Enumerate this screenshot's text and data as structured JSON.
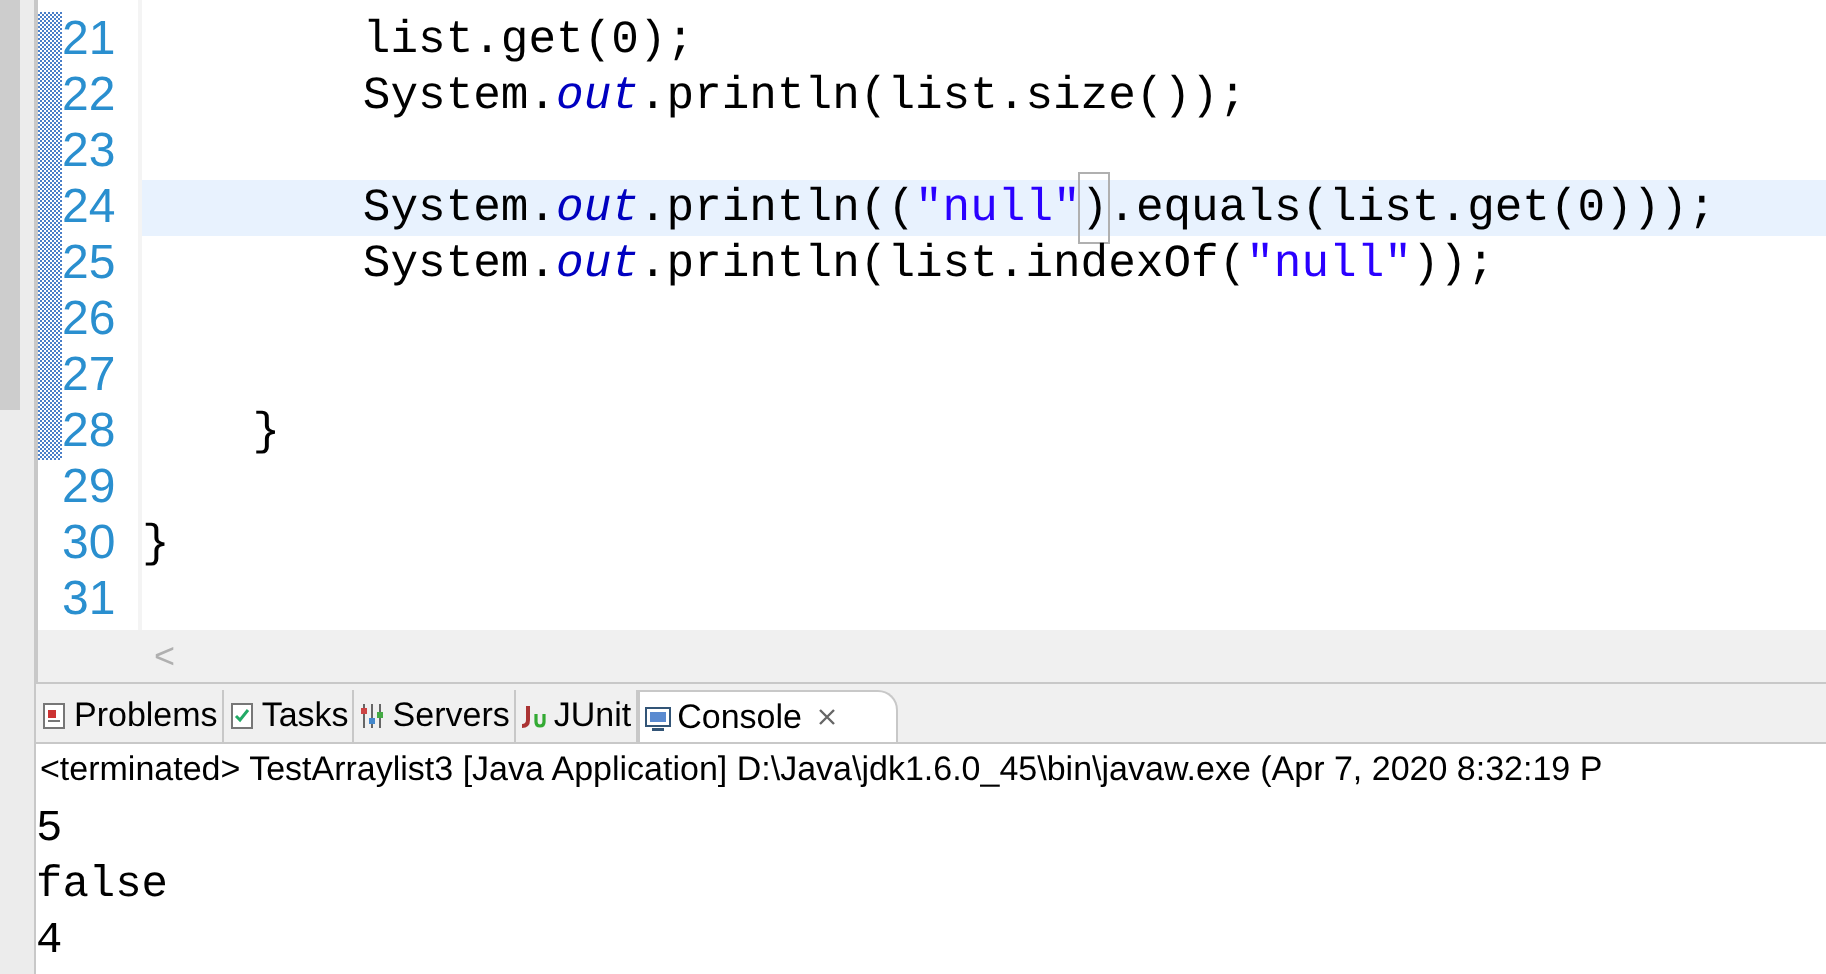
{
  "editor": {
    "lines": [
      {
        "number": "21",
        "current": false,
        "segments": [
          {
            "kind": "plain",
            "text": "        list.get(0);"
          }
        ]
      },
      {
        "number": "22",
        "current": false,
        "segments": [
          {
            "kind": "plain",
            "text": "        System."
          },
          {
            "kind": "field",
            "text": "out"
          },
          {
            "kind": "plain",
            "text": ".println(list.size());"
          }
        ]
      },
      {
        "number": "23",
        "current": false
      },
      {
        "number": "24",
        "current": true,
        "segments": [
          {
            "kind": "plain",
            "text": "        System."
          },
          {
            "kind": "field",
            "text": "out"
          },
          {
            "kind": "plain",
            "text": ".println(("
          },
          {
            "kind": "string",
            "text": "\"null\""
          },
          {
            "kind": "bracket",
            "text": ")"
          },
          {
            "kind": "plain",
            "text": ".equals(list.get(0)));"
          }
        ]
      },
      {
        "number": "25",
        "current": false,
        "segments": [
          {
            "kind": "plain",
            "text": "        System."
          },
          {
            "kind": "field",
            "text": "out"
          },
          {
            "kind": "plain",
            "text": ".println(list.indexOf("
          },
          {
            "kind": "string",
            "text": "\"null\""
          },
          {
            "kind": "plain",
            "text": "));"
          }
        ]
      },
      {
        "number": "26",
        "current": false
      },
      {
        "number": "27",
        "current": false
      },
      {
        "number": "28",
        "current": false,
        "segments": [
          {
            "kind": "plain",
            "text": "    }"
          }
        ]
      },
      {
        "number": "29",
        "current": false
      },
      {
        "number": "30",
        "current": false,
        "segments": [
          {
            "kind": "plain",
            "text": "}"
          }
        ]
      },
      {
        "number": "31",
        "current": false
      }
    ]
  },
  "scroll_arrow": "<",
  "tabs": [
    {
      "label": "Problems",
      "kind": "problems",
      "selected": false
    },
    {
      "label": "Tasks",
      "kind": "tasks",
      "selected": false
    },
    {
      "label": "Servers",
      "kind": "servers",
      "selected": false
    },
    {
      "label": "JUnit",
      "kind": "junit",
      "selected": false
    },
    {
      "label": "Console",
      "kind": "console",
      "selected": true
    }
  ],
  "console": {
    "header": "<terminated> TestArraylist3 [Java Application] D:\\Java\\jdk1.6.0_45\\bin\\javaw.exe (Apr 7, 2020 8:32:19 P",
    "output": [
      "5",
      "false",
      "4"
    ]
  }
}
